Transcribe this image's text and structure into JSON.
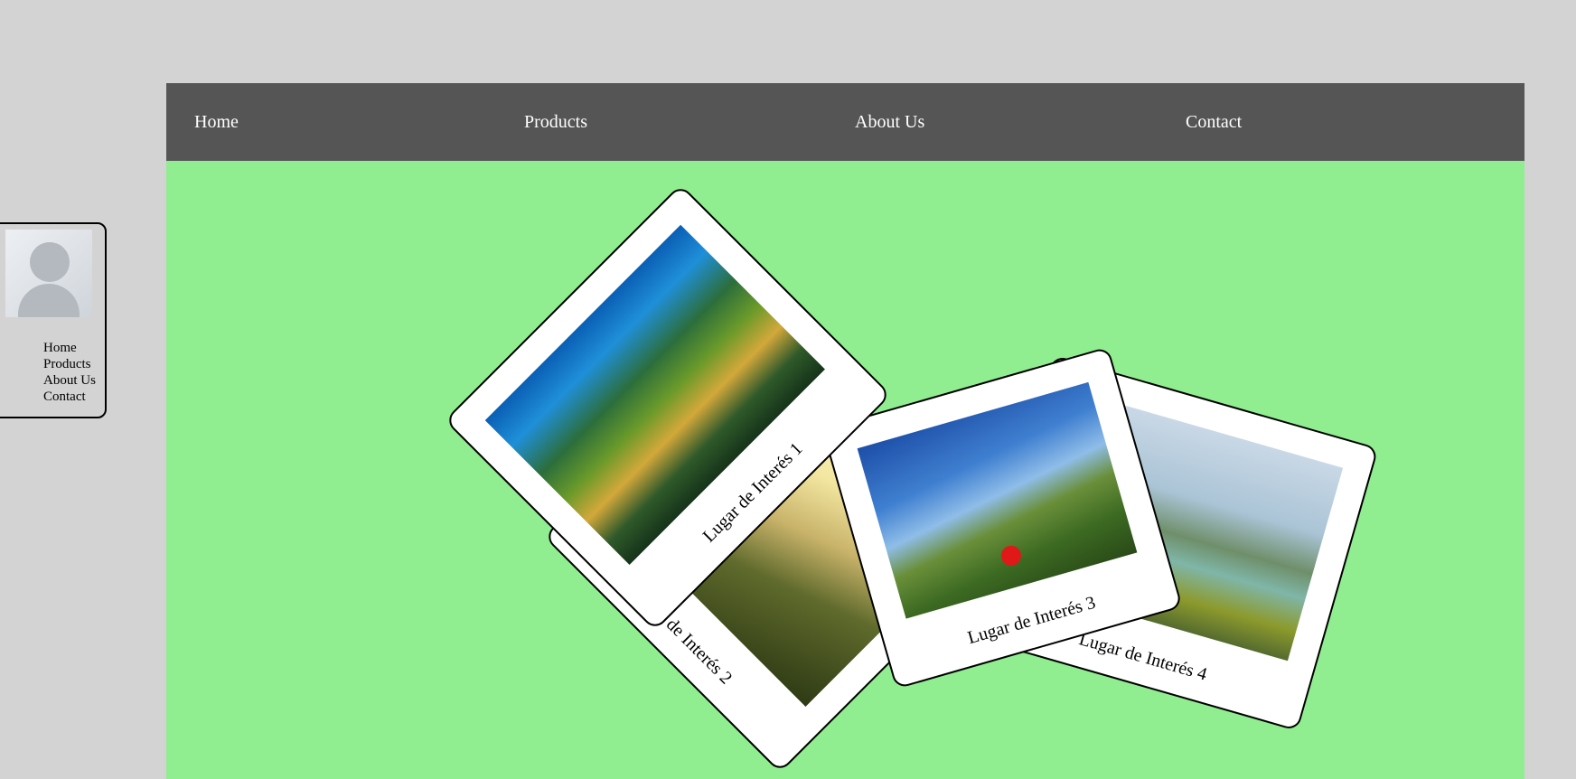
{
  "topnav": {
    "items": [
      "Home",
      "Products",
      "About Us",
      "Contact"
    ]
  },
  "sidebar": {
    "items": [
      "Home",
      "Products",
      "About Us",
      "Contact"
    ]
  },
  "gallery": {
    "cards": [
      {
        "caption": "Lugar de Interés 1"
      },
      {
        "caption": "Lugar de Interés 2"
      },
      {
        "caption": "Lugar de Interés 3"
      },
      {
        "caption": "Lugar de Interés 4"
      }
    ]
  },
  "colors": {
    "page_bg": "#d3d3d3",
    "nav_bg": "#555555",
    "stage_bg": "#90ee90",
    "card_bg": "#ffffff"
  }
}
